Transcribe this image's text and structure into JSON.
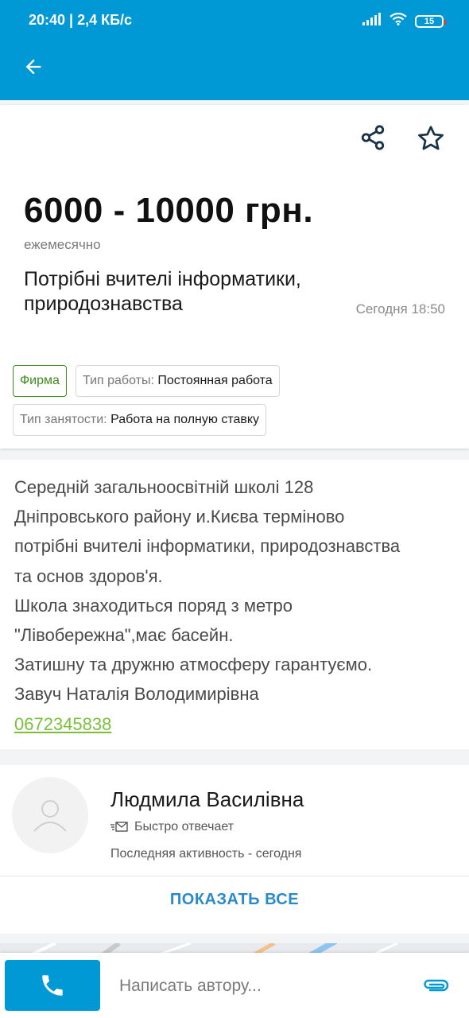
{
  "status_bar": {
    "time_speed": "20:40 | 2,4 КБ/с",
    "battery": "15"
  },
  "listing": {
    "price": "6000 - 10000 грн.",
    "period": "ежемесячно",
    "title": "Потрібні вчителі інформатики, природознавства",
    "date": "Сегодня 18:50",
    "tags": {
      "firm": "Фирма",
      "work_type_label": "Тип работы:",
      "work_type_value": "Постоянная работа",
      "employment_label": "Тип занятости:",
      "employment_value": "Работа на полную ставку"
    },
    "description_lines": [
      "Середній загальноосвітній школі 128",
      "Дніпровського району и.Києва терміново",
      "потрібні вчителі інформатики, природознавства",
      "та основ здоров'я.",
      "Школа знаходиться поряд з метро",
      "\"Лівобережна\",має басейн.",
      "Затишну та дружню атмосферу гарантуємо.",
      "Завуч Наталія Володимирівна"
    ],
    "phone": "0672345838"
  },
  "author": {
    "name": "Людмила Василівна",
    "fast_reply": "Быстро отвечает",
    "last_activity": "Последняя активность - сегодня",
    "show_all": "ПОКАЗАТЬ ВСЕ"
  },
  "bottom_bar": {
    "message_placeholder": "Написать автору..."
  },
  "icons": [
    "arrow-back-icon",
    "share-icon",
    "star-outline-icon",
    "user-placeholder-icon",
    "message-icon",
    "phone-icon",
    "paperclip-icon",
    "signal-icon",
    "wifi-icon"
  ],
  "colors": {
    "primary": "#0099d6",
    "firm_green": "#3f8c1c",
    "phone_link": "#7cbf3c",
    "show_all": "#2a8bc8"
  }
}
